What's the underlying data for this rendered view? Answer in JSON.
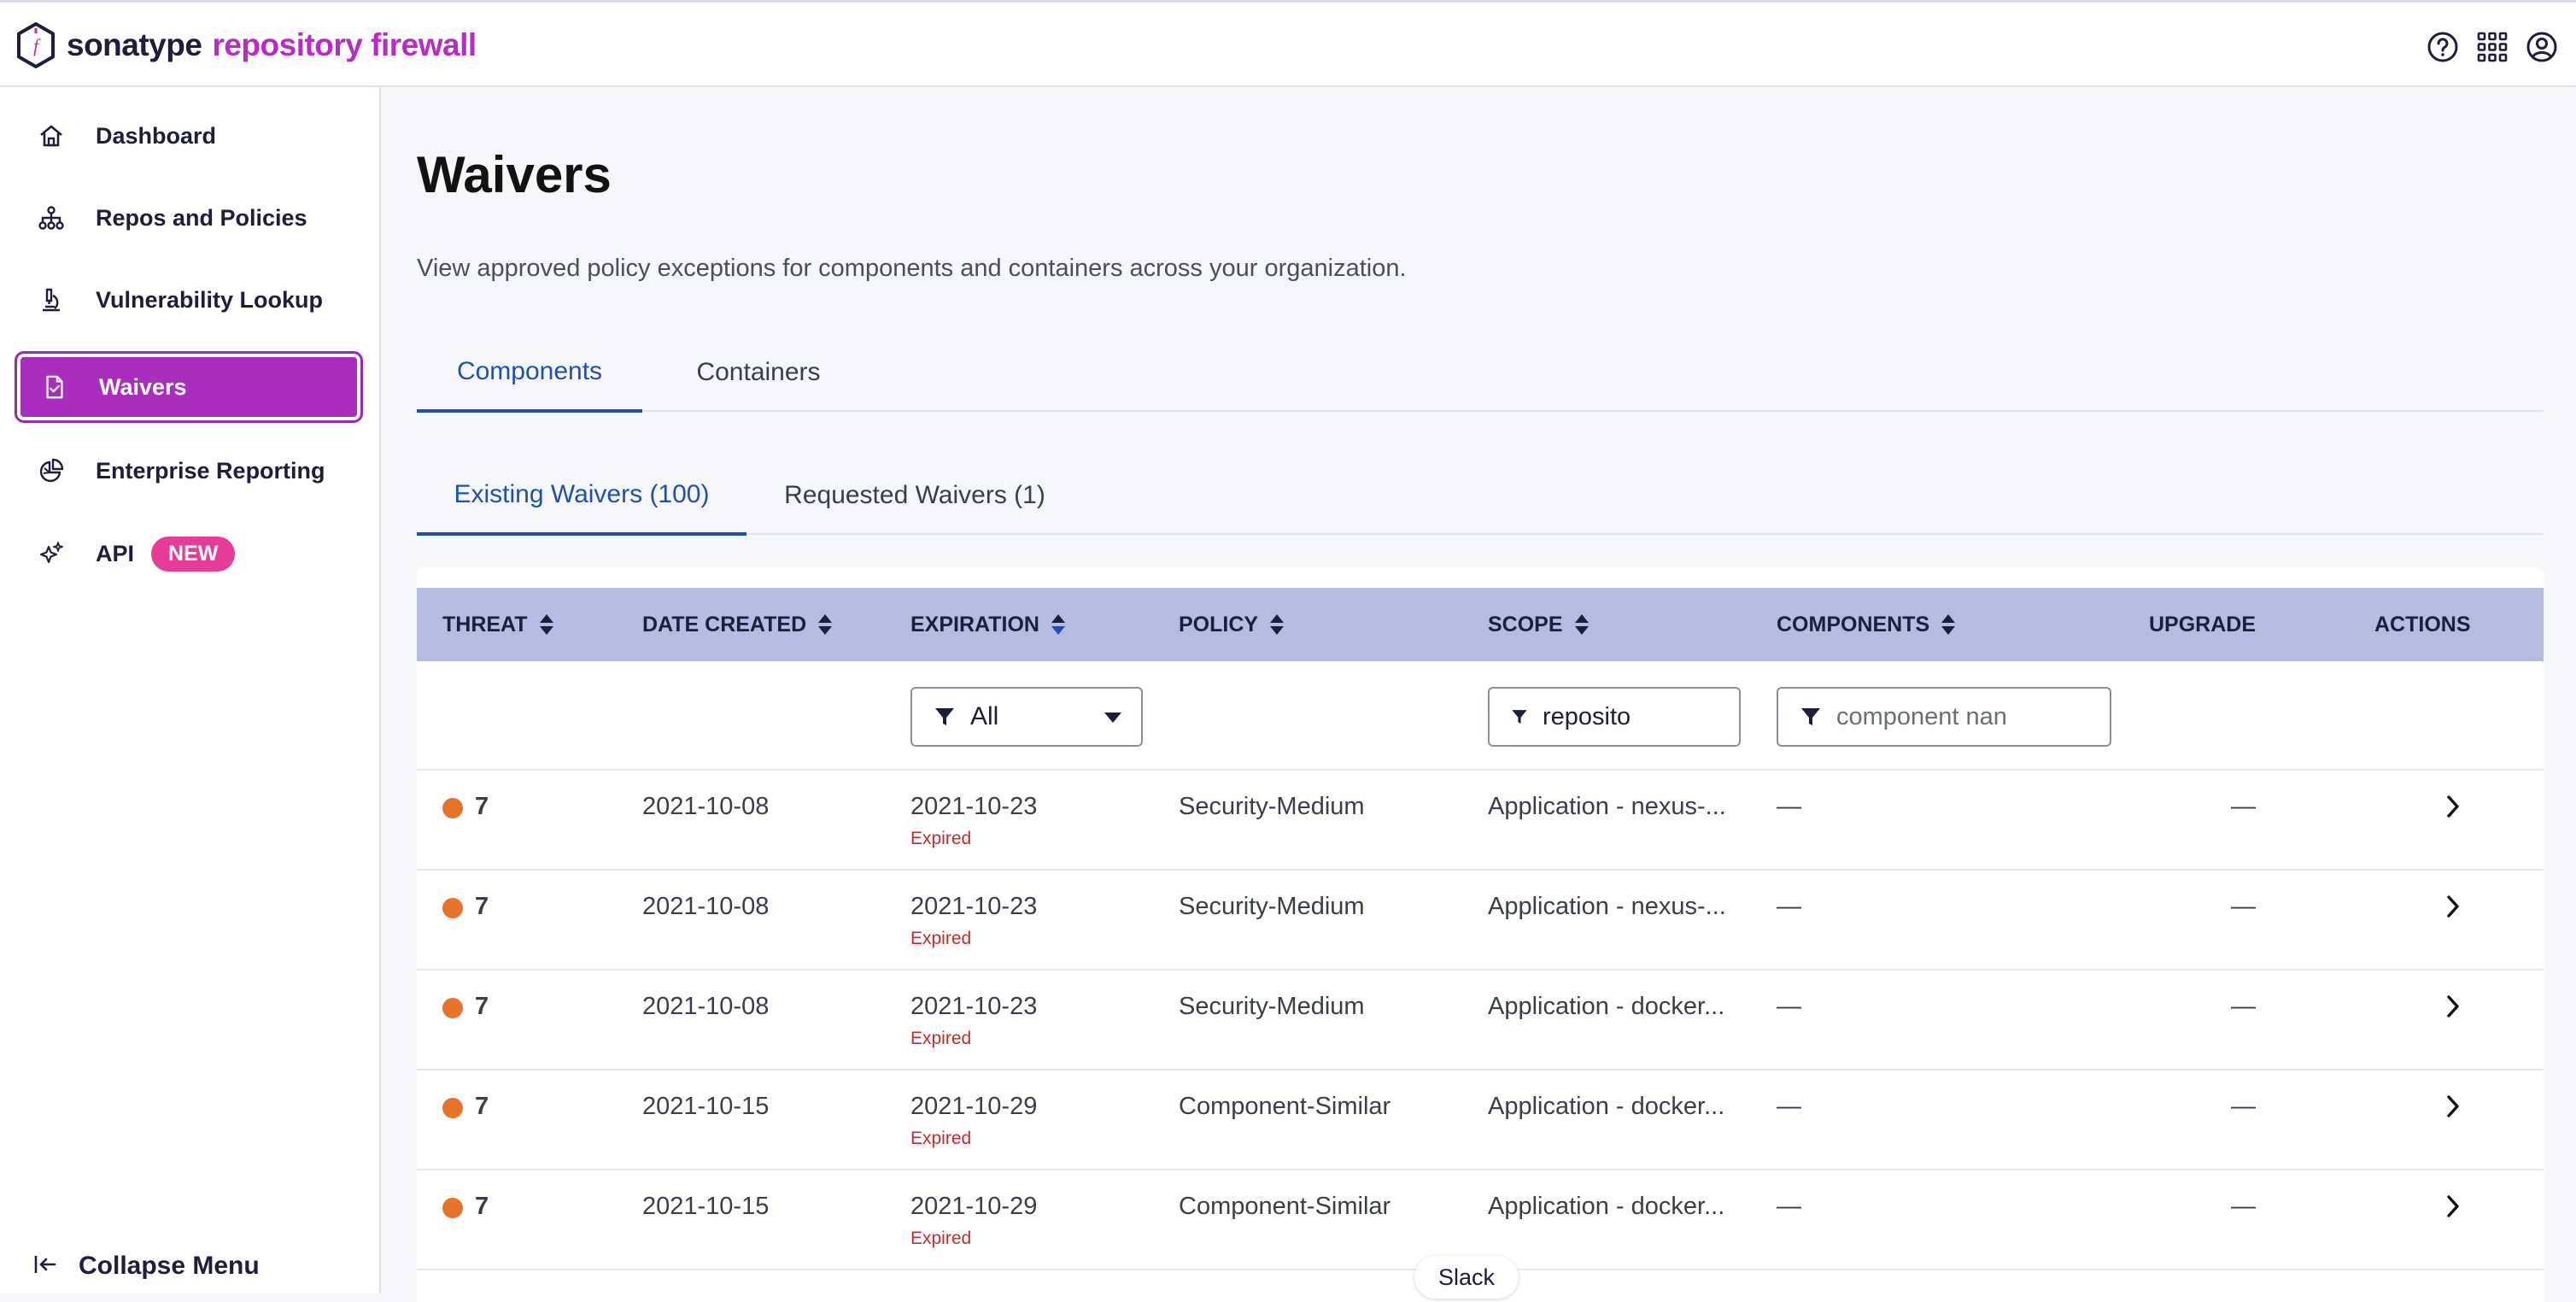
{
  "app": {
    "brand": "sonatype",
    "product": "repository firewall"
  },
  "top_icons": [
    "help-icon",
    "apps-grid-icon",
    "user-account-icon"
  ],
  "sidebar": {
    "items": [
      {
        "label": "Dashboard",
        "icon": "home-icon"
      },
      {
        "label": "Repos and Policies",
        "icon": "hierarchy-icon"
      },
      {
        "label": "Vulnerability Lookup",
        "icon": "microscope-icon"
      },
      {
        "label": "Waivers",
        "icon": "document-check-icon",
        "active": true
      },
      {
        "label": "Enterprise Reporting",
        "icon": "pie-chart-icon"
      },
      {
        "label": "API",
        "icon": "sparkle-icon",
        "badge": "NEW"
      }
    ],
    "collapse_label": "Collapse Menu"
  },
  "page": {
    "title": "Waivers",
    "description": "View approved policy exceptions for components and containers across your organization."
  },
  "tabs": {
    "primary": [
      {
        "label": "Components",
        "active": true
      },
      {
        "label": "Containers",
        "active": false
      }
    ],
    "secondary": [
      {
        "label": "Existing Waivers (100)",
        "active": true
      },
      {
        "label": "Requested Waivers (1)",
        "active": false
      }
    ]
  },
  "table": {
    "columns": [
      "THREAT",
      "DATE CREATED",
      "EXPIRATION",
      "POLICY",
      "SCOPE",
      "COMPONENTS",
      "UPGRADE",
      "ACTIONS"
    ],
    "filters": {
      "expiration_value": "All",
      "scope_value": "reposito",
      "components_placeholder": "component nan"
    },
    "rows": [
      {
        "threat": "7",
        "date_created": "2021-10-08",
        "expiration": "2021-10-23",
        "status": "Expired",
        "policy": "Security-Medium",
        "scope": "Application - nexus-...",
        "components": "—",
        "upgrade": "—"
      },
      {
        "threat": "7",
        "date_created": "2021-10-08",
        "expiration": "2021-10-23",
        "status": "Expired",
        "policy": "Security-Medium",
        "scope": "Application - nexus-...",
        "components": "—",
        "upgrade": "—"
      },
      {
        "threat": "7",
        "date_created": "2021-10-08",
        "expiration": "2021-10-23",
        "status": "Expired",
        "policy": "Security-Medium",
        "scope": "Application - docker...",
        "components": "—",
        "upgrade": "—"
      },
      {
        "threat": "7",
        "date_created": "2021-10-15",
        "expiration": "2021-10-29",
        "status": "Expired",
        "policy": "Component-Similar",
        "scope": "Application - docker...",
        "components": "—",
        "upgrade": "—"
      },
      {
        "threat": "7",
        "date_created": "2021-10-15",
        "expiration": "2021-10-29",
        "status": "Expired",
        "policy": "Component-Similar",
        "scope": "Application - docker...",
        "components": "—",
        "upgrade": "—"
      }
    ]
  },
  "slack_label": "Slack",
  "colors": {
    "brand_purple": "#b92bc4",
    "active_nav": "#a92ec0",
    "new_badge": "#e63b97",
    "tab_active": "#1f4fb5",
    "table_header": "#b4bce2",
    "threat_dot": "#e8742c",
    "expired_text": "#c52a2a"
  }
}
